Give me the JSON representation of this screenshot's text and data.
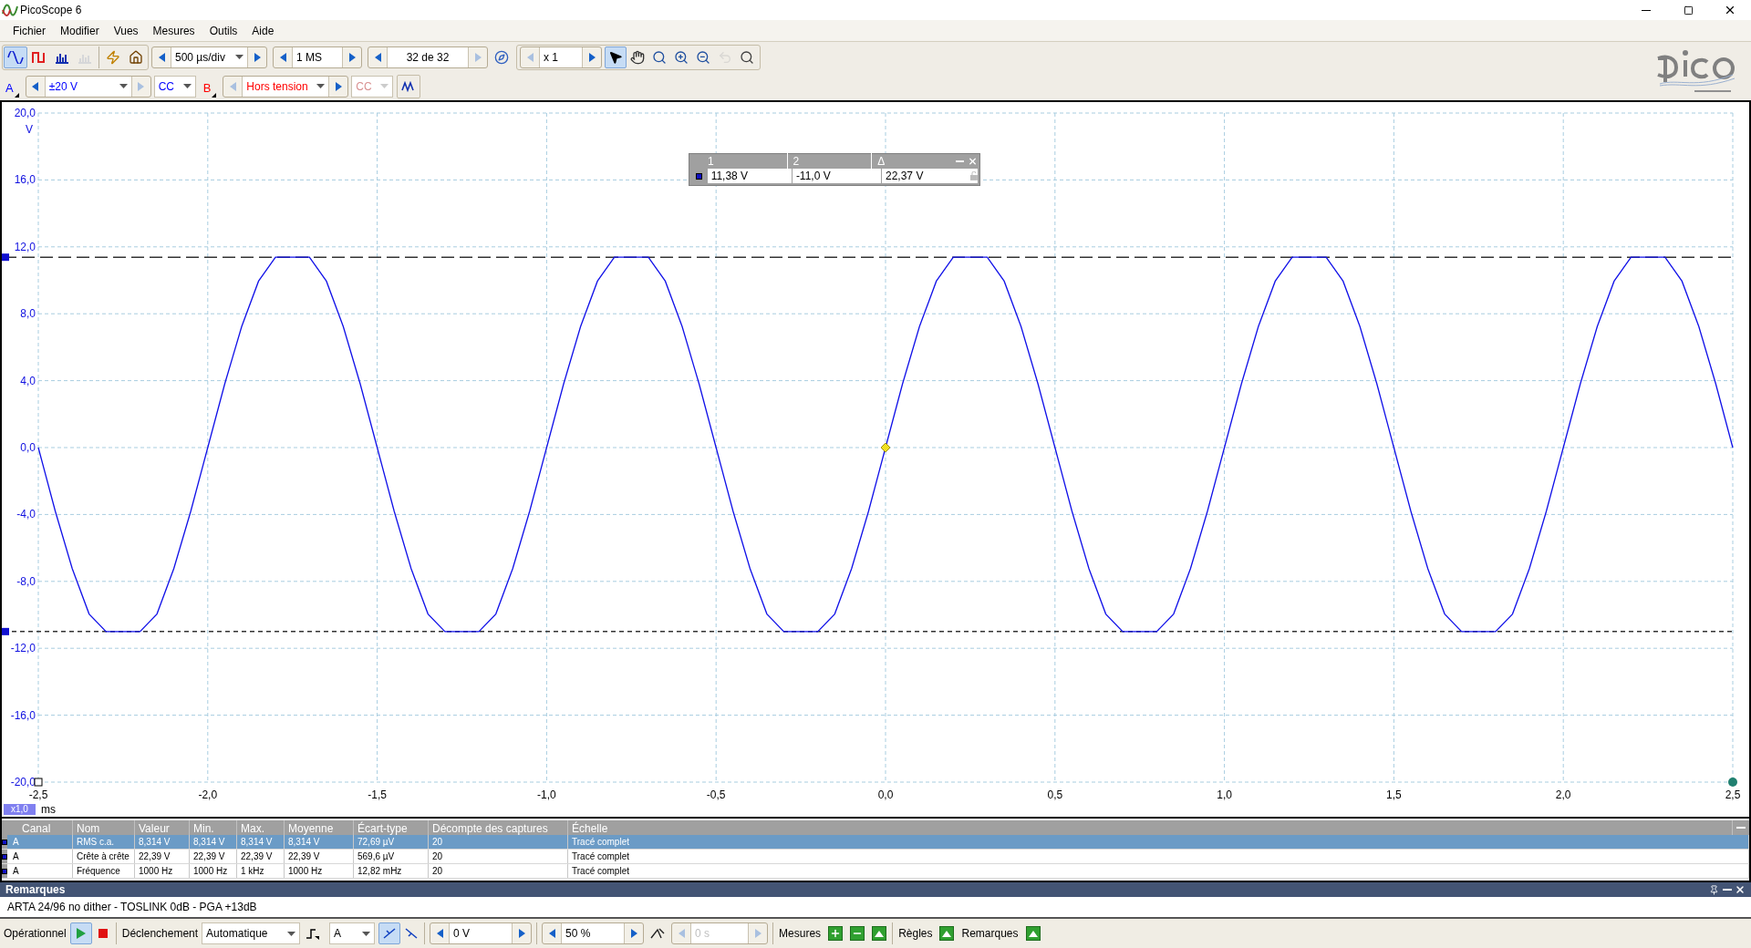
{
  "window": {
    "title": "PicoScope 6"
  },
  "menu": [
    "Fichier",
    "Modifier",
    "Vues",
    "Mesures",
    "Outils",
    "Aide"
  ],
  "toolbar": {
    "view_buttons": [
      {
        "kind": "scope",
        "selected": true,
        "disabled": false
      },
      {
        "kind": "persistence",
        "selected": false,
        "disabled": false
      },
      {
        "kind": "spectrum",
        "selected": false,
        "disabled": false
      },
      {
        "kind": "xy",
        "selected": false,
        "disabled": true
      }
    ],
    "timebase": "500 µs/div",
    "samples": "1 MS",
    "buffer": "32 de 32",
    "zoom_factor": "x 1",
    "tools": [
      {
        "kind": "pointer",
        "selected": true,
        "disabled": false
      },
      {
        "kind": "hand",
        "selected": false,
        "disabled": false
      },
      {
        "kind": "zoom-area",
        "selected": false,
        "disabled": false
      },
      {
        "kind": "zoom-in",
        "selected": false,
        "disabled": false
      },
      {
        "kind": "zoom-out",
        "selected": false,
        "disabled": false
      },
      {
        "kind": "undo",
        "selected": false,
        "disabled": true
      },
      {
        "kind": "zoom-fit",
        "selected": false,
        "disabled": false
      }
    ]
  },
  "channels": [
    {
      "label": "A",
      "color": "#0000ff",
      "range": "±20 V",
      "coupling": "CC",
      "coupling_disabled": false
    },
    {
      "label": "B",
      "color": "#ff0000",
      "range": "Hors tension",
      "coupling": "CC",
      "coupling_disabled": true
    }
  ],
  "scope": {
    "zoom_badge": "x1,0",
    "chart_data": {
      "type": "line",
      "xlabel": "ms",
      "ylabel": "V",
      "xlim": [
        -2.5,
        2.5
      ],
      "ylim": [
        -20,
        20
      ],
      "xticks": [
        {
          "value": -2.5,
          "label": "-2,5"
        },
        {
          "value": -2,
          "label": "-2,0"
        },
        {
          "value": -1.5,
          "label": "-1,5"
        },
        {
          "value": -1,
          "label": "-1,0"
        },
        {
          "value": -0.5,
          "label": "-0,5"
        },
        {
          "value": 0,
          "label": "0,0"
        },
        {
          "value": 0.5,
          "label": "0,5"
        },
        {
          "value": 1,
          "label": "1,0"
        },
        {
          "value": 1.5,
          "label": "1,5"
        },
        {
          "value": 2,
          "label": "2,0"
        },
        {
          "value": 2.5,
          "label": "2,5"
        }
      ],
      "yticks": [
        {
          "value": 20,
          "label": "20,0"
        },
        {
          "value": 16,
          "label": "16,0"
        },
        {
          "value": 12,
          "label": "12,0"
        },
        {
          "value": 8,
          "label": "8,0"
        },
        {
          "value": 4,
          "label": "4,0"
        },
        {
          "value": 0,
          "label": "0,0"
        },
        {
          "value": -4,
          "label": "-4,0"
        },
        {
          "value": -8,
          "label": "-8,0"
        },
        {
          "value": -12,
          "label": "-12,0"
        },
        {
          "value": -16,
          "label": "-16,0"
        },
        {
          "value": -20,
          "label": "-20,0"
        }
      ],
      "x": [
        -2.5,
        -2.45,
        -2.4,
        -2.35,
        -2.3,
        -2.25,
        -2.2,
        -2.15,
        -2.1,
        -2.05,
        -2,
        -1.95,
        -1.9,
        -1.85,
        -1.8,
        -1.75,
        -1.7,
        -1.65,
        -1.6,
        -1.55,
        -1.5,
        -1.45,
        -1.4,
        -1.35,
        -1.3,
        -1.25,
        -1.2,
        -1.15,
        -1.1,
        -1.05,
        -1,
        -0.95,
        -0.9,
        -0.85,
        -0.8,
        -0.75,
        -0.7,
        -0.65,
        -0.6,
        -0.55,
        -0.5,
        -0.45,
        -0.4,
        -0.35,
        -0.3,
        -0.25,
        -0.2,
        -0.15,
        -0.1,
        -0.05,
        0,
        0.05,
        0.1,
        0.15,
        0.2,
        0.25,
        0.3,
        0.35,
        0.4,
        0.45,
        0.5,
        0.55,
        0.6,
        0.65,
        0.7,
        0.75,
        0.8,
        0.85,
        0.9,
        0.95,
        1,
        1.05,
        1.1,
        1.15,
        1.2,
        1.25,
        1.3,
        1.35,
        1.4,
        1.45,
        1.5,
        1.55,
        1.6,
        1.65,
        1.7,
        1.75,
        1.8,
        1.85,
        1.9,
        1.95,
        2,
        2.05,
        2.1,
        2.15,
        2.2,
        2.25,
        2.3,
        2.35,
        2.4,
        2.45,
        2.5
      ],
      "series": [
        {
          "color": "#1010e8",
          "values": [
            0,
            -3.8,
            -7.23,
            -9.95,
            -11,
            -11,
            -11,
            -9.95,
            -7.23,
            -3.8,
            0,
            3.8,
            7.23,
            9.95,
            11.38,
            11.38,
            11.38,
            9.95,
            7.23,
            3.8,
            0,
            -3.8,
            -7.23,
            -9.95,
            -11,
            -11,
            -11,
            -9.95,
            -7.23,
            -3.8,
            0,
            3.8,
            7.23,
            9.95,
            11.38,
            11.38,
            11.38,
            9.95,
            7.23,
            3.8,
            0,
            -3.8,
            -7.23,
            -9.95,
            -11,
            -11,
            -11,
            -9.95,
            -7.23,
            -3.8,
            0,
            3.8,
            7.23,
            9.95,
            11.38,
            11.38,
            11.38,
            9.95,
            7.23,
            3.8,
            0,
            -3.8,
            -7.23,
            -9.95,
            -11,
            -11,
            -11,
            -9.95,
            -7.23,
            -3.8,
            0,
            3.8,
            7.23,
            9.95,
            11.38,
            11.38,
            11.38,
            9.95,
            7.23,
            3.8,
            0,
            -3.8,
            -7.23,
            -9.95,
            -11,
            -11,
            -11,
            -9.95,
            -7.23,
            -3.8,
            0,
            3.8,
            7.23,
            9.95,
            11.38,
            11.38,
            11.38,
            9.95,
            7.23,
            3.8,
            0
          ]
        }
      ],
      "grid": true,
      "ref_lines": [
        {
          "axis": "y",
          "value": 11.38
        },
        {
          "axis": "y",
          "value": -11.0
        }
      ]
    }
  },
  "ruler_legend": {
    "columns": [
      "1",
      "2",
      "Δ"
    ],
    "values": [
      "11,38 V",
      "-11,0 V",
      "22,37 V"
    ]
  },
  "measurements": {
    "columns": [
      "Canal",
      "Nom",
      "Valeur",
      "Min.",
      "Max.",
      "Moyenne",
      "Écart-type",
      "Décompte des captures",
      "Échelle"
    ],
    "rows": [
      {
        "selected": true,
        "cells": [
          "A",
          "RMS c.a.",
          "8,314 V",
          "8,314 V",
          "8,314 V",
          "8,314 V",
          "72,69 µV",
          "20",
          "Tracé complet"
        ]
      },
      {
        "selected": false,
        "cells": [
          "A",
          "Crête à crête",
          "22,39 V",
          "22,39 V",
          "22,39 V",
          "22,39 V",
          "569,6 µV",
          "20",
          "Tracé complet"
        ]
      },
      {
        "selected": false,
        "cells": [
          "A",
          "Fréquence",
          "1000 Hz",
          "1000 Hz",
          "1 kHz",
          "1000 Hz",
          "12,82 mHz",
          "20",
          "Tracé complet"
        ]
      }
    ]
  },
  "remarks": {
    "title": "Remarques",
    "text": "ARTA 24/96 no dither - TOSLINK 0dB - PGA +13dB"
  },
  "status_bar": {
    "run_label": "Opérationnel",
    "running": true,
    "trigger_label": "Déclenchement",
    "trigger_mode": "Automatique",
    "trigger_source": "A",
    "edge_rising": true,
    "threshold": "0 V",
    "pretrigger": "50 %",
    "delay": "0 s",
    "measures_label": "Mesures",
    "rulers_label": "Règles",
    "remarks_label": "Remarques"
  }
}
